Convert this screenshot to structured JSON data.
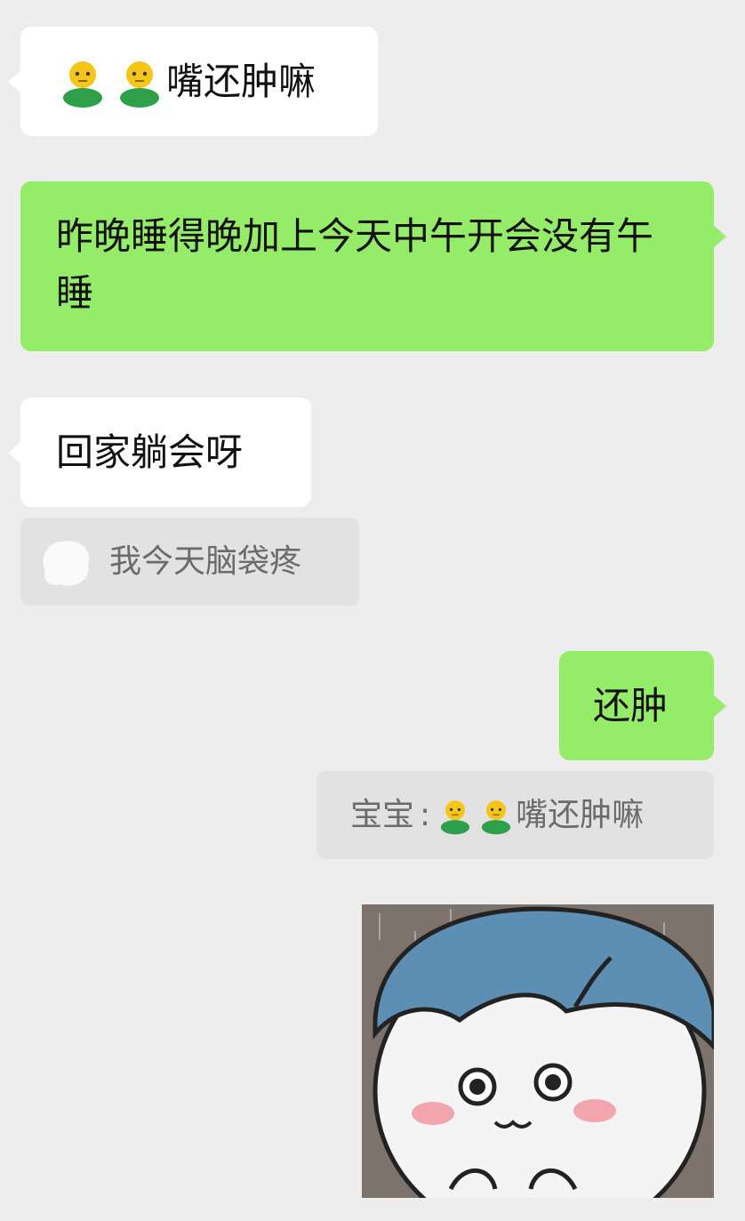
{
  "messages": [
    {
      "side": "left",
      "emoji": [
        "person-emoji",
        "person-emoji"
      ],
      "text": "嘴还肿嘛"
    },
    {
      "side": "right",
      "text": "昨晚睡得晚加上今天中午开会没有午睡"
    },
    {
      "side": "left",
      "text": "回家躺会呀"
    },
    {
      "side": "right",
      "text": "还肿"
    }
  ],
  "quotes": [
    {
      "text": "我今天脑袋疼"
    },
    {
      "sender": "宝宝",
      "separator": ":",
      "text": "嘴还肿嘛"
    }
  ],
  "colors": {
    "background": "#ededed",
    "incoming_bubble": "#ffffff",
    "outgoing_bubble": "#95ec69",
    "quote_bg": "#e2e2e2",
    "quote_text": "#6b6b6b"
  }
}
